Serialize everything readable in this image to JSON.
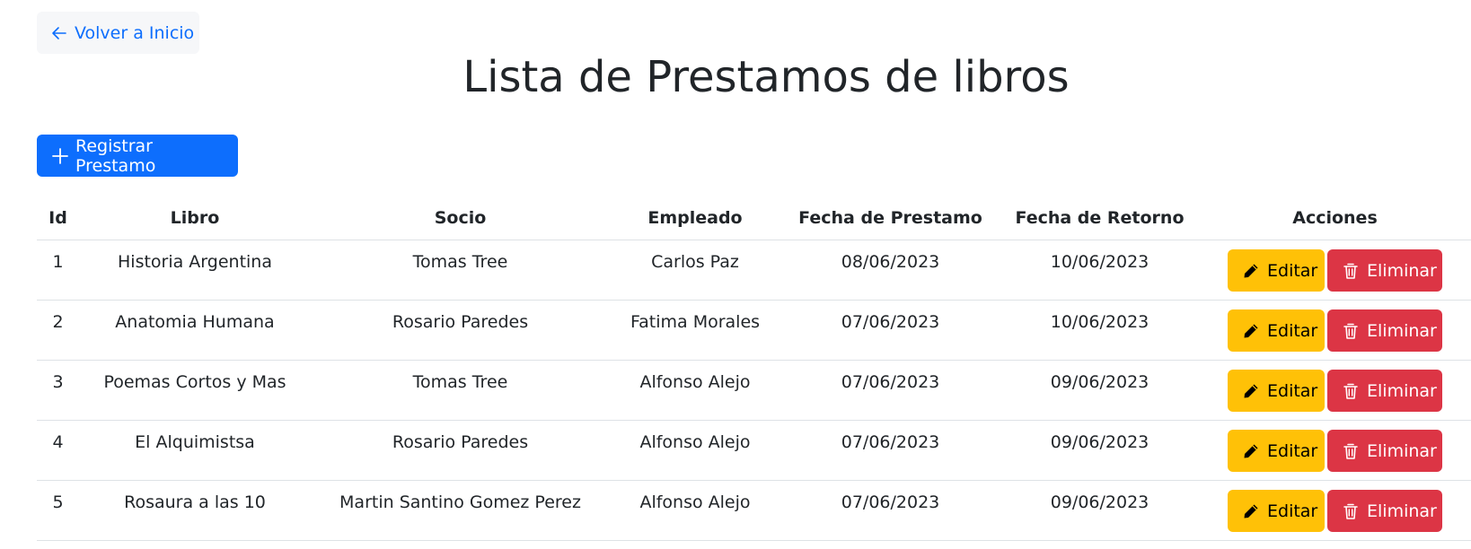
{
  "nav": {
    "back_label": "Volver a Inicio",
    "back_icon": "arrow-left-icon"
  },
  "page": {
    "title": "Lista de Prestamos de libros"
  },
  "toolbar": {
    "register_label": "Registrar Prestamo",
    "register_icon": "plus-icon"
  },
  "table": {
    "columns": [
      "Id",
      "Libro",
      "Socio",
      "Empleado",
      "Fecha de Prestamo",
      "Fecha de Retorno",
      "Acciones"
    ],
    "rows": [
      {
        "id": "1",
        "libro": "Historia Argentina",
        "socio": "Tomas Tree",
        "empleado": "Carlos Paz",
        "fecha_prestamo": "08/06/2023",
        "fecha_retorno": "10/06/2023"
      },
      {
        "id": "2",
        "libro": "Anatomia Humana",
        "socio": "Rosario Paredes",
        "empleado": "Fatima Morales",
        "fecha_prestamo": "07/06/2023",
        "fecha_retorno": "10/06/2023"
      },
      {
        "id": "3",
        "libro": "Poemas Cortos y Mas",
        "socio": "Tomas Tree",
        "empleado": "Alfonso Alejo",
        "fecha_prestamo": "07/06/2023",
        "fecha_retorno": "09/06/2023"
      },
      {
        "id": "4",
        "libro": "El Alquimistsa",
        "socio": "Rosario Paredes",
        "empleado": "Alfonso Alejo",
        "fecha_prestamo": "07/06/2023",
        "fecha_retorno": "09/06/2023"
      },
      {
        "id": "5",
        "libro": "Rosaura a las 10",
        "socio": "Martin Santino Gomez Perez",
        "empleado": "Alfonso Alejo",
        "fecha_prestamo": "07/06/2023",
        "fecha_retorno": "09/06/2023"
      }
    ],
    "actions": {
      "edit_label": "Editar",
      "edit_icon": "pencil-icon",
      "delete_label": "Eliminar",
      "delete_icon": "trash-icon"
    }
  },
  "colors": {
    "primary": "#0d6efd",
    "warning": "#ffc107",
    "danger": "#dc3545",
    "text": "#212529",
    "back_button_bg": "#f6f7f9"
  }
}
